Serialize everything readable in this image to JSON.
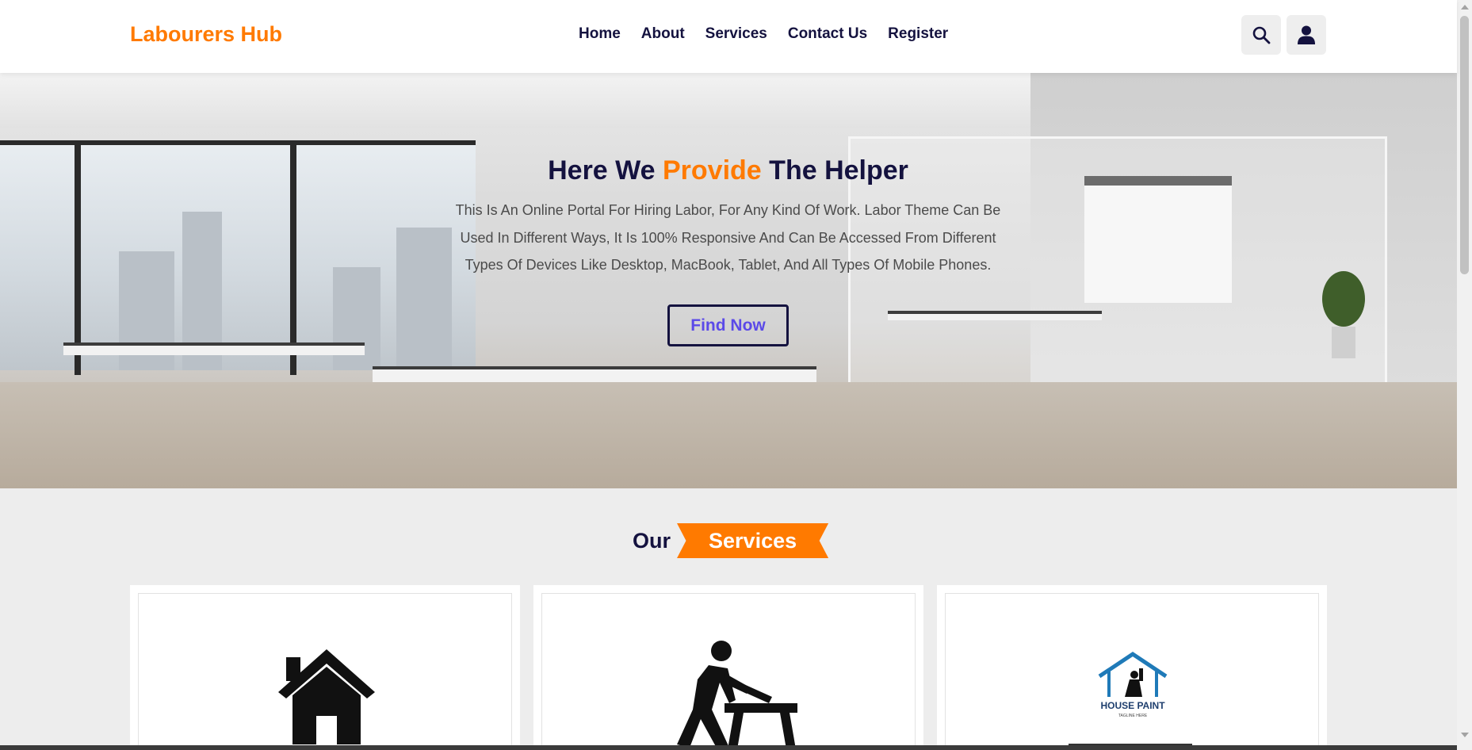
{
  "brand": {
    "name": "Labourers Hub",
    "color": "#ff7a00"
  },
  "nav": {
    "items": [
      {
        "label": "Home"
      },
      {
        "label": "About"
      },
      {
        "label": "Services"
      },
      {
        "label": "Contact Us"
      },
      {
        "label": "Register"
      }
    ]
  },
  "header_icons": {
    "search": "search-icon",
    "user": "user-icon"
  },
  "hero": {
    "title_part1": "Here We",
    "title_highlight": "Provide",
    "title_part2": "The Helper",
    "description": "This Is An Online Portal For Hiring Labor, For Any Kind Of Work. Labor Theme Can Be Used In Different Ways, It Is 100% Responsive And Can Be Accessed From Different Types Of Devices Like Desktop, MacBook, Tablet, And All Types Of Mobile Phones.",
    "button_label": "Find Now"
  },
  "services": {
    "title_prefix": "Our",
    "title_ribbon": "Services",
    "cards": [
      {
        "icon": "house-icon"
      },
      {
        "icon": "carpenter-icon"
      },
      {
        "icon": "house-paint-logo",
        "logo_text": "HOUSE PAINT",
        "logo_tagline": "TAGLINE HERE"
      }
    ]
  },
  "colors": {
    "accent": "#ff7a00",
    "dark": "#14123f",
    "button_text": "#5b4ae8"
  }
}
